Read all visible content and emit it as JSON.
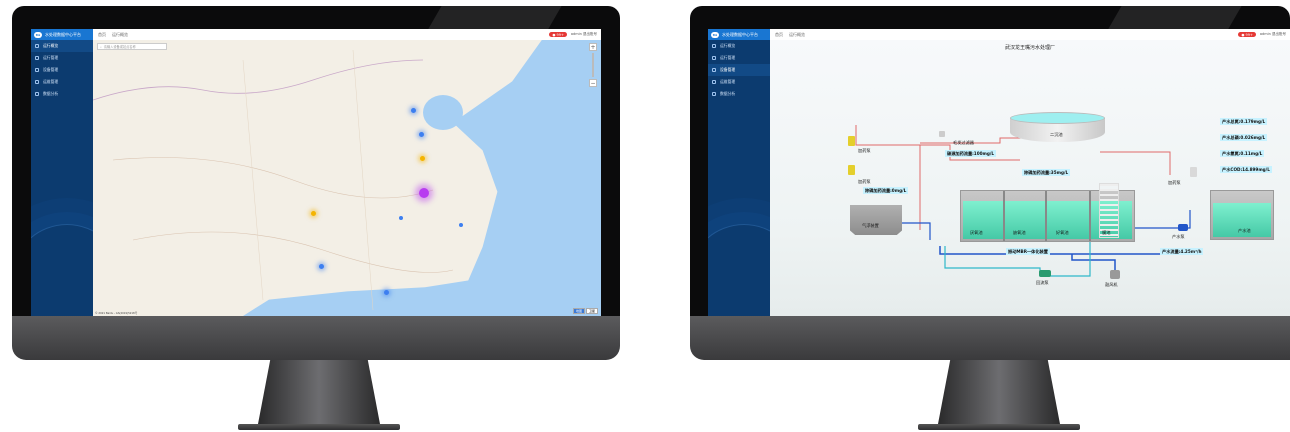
{
  "app": {
    "logo_text": "tlz",
    "title": "水处理数据中心平台",
    "breadcrumb_home": "首页",
    "breadcrumb_current": "运行概览",
    "alert_badge": "● 99+",
    "user_label": "admin 退出账号"
  },
  "sidebar": {
    "items": [
      {
        "label": "运行概览"
      },
      {
        "label": "运行管理"
      },
      {
        "label": "设备管理"
      },
      {
        "label": "运维管理"
      },
      {
        "label": "数据分析"
      }
    ]
  },
  "map": {
    "search_placeholder": "请输入设备或站点名称",
    "zoom_in": "+",
    "zoom_out": "−",
    "type_map": "地图",
    "type_satellite": "卫星",
    "copyright": "© 2021 Baidu - GS(2019)5218号",
    "markers": [
      {
        "color": "#3d7ff0",
        "size": 5
      },
      {
        "color": "#3d7ff0",
        "size": 5
      },
      {
        "color": "#f4b400",
        "size": 5
      },
      {
        "color": "#b83cf0",
        "size": 10
      },
      {
        "color": "#f4b400",
        "size": 5
      },
      {
        "color": "#3d7ff0",
        "size": 4
      },
      {
        "color": "#3d7ff0",
        "size": 4
      },
      {
        "color": "#3d7ff0",
        "size": 5
      },
      {
        "color": "#3d7ff0",
        "size": 5
      }
    ]
  },
  "plant": {
    "title": "武汉龙王嘴污水处理厂",
    "labels": {
      "dosing_pump_1": "加药泵",
      "dosing_pump_2": "加药泵",
      "dosing_pump_3": "加药泵",
      "filter": "毛发过滤器",
      "clarifier": "二沉池",
      "flotation": "气浮装置",
      "anaerobic": "厌氧池",
      "anoxic": "缺氧池",
      "aerobic": "好氧池",
      "membrane": "膜池",
      "mbr": "振动MBR一体化装置",
      "return_pump": "回流泵",
      "blower": "鼓风机",
      "product_pump": "产水泵",
      "product_tank": "产水池"
    },
    "readings": {
      "phosphorus_dose": "除磷加药流量:0mg/L",
      "carbon_dose": "碳源加药流量:100mg/L",
      "pac_dose": "除磷加药流量:35mg/L",
      "total_n": "产水总氮:0.179mg/L",
      "total_p": "产水总磷:0.026mg/L",
      "ammonia": "产水氨氮:0.11mg/L",
      "cod": "产水COD:14.899mg/L",
      "flow": "产水流量:4.25m³/h"
    },
    "colors": {
      "water": "#52d9b4",
      "pipe_blue": "#2155c9",
      "pipe_red": "#e06a6a",
      "pipe_cyan": "#2fb8c9"
    }
  }
}
